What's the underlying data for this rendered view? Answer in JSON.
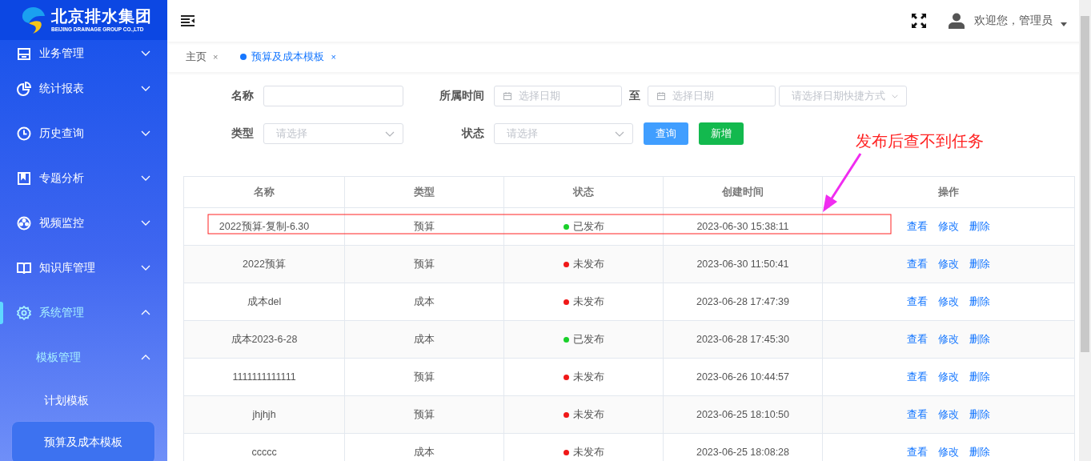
{
  "logo": {
    "title": "北京排水集团",
    "subtitle": "BEIJING DRAINAGE GROUP CO.,LTD"
  },
  "sidebar": {
    "items": [
      {
        "label": "业务管理",
        "expanded": false
      },
      {
        "label": "统计报表",
        "expanded": false
      },
      {
        "label": "历史查询",
        "expanded": false
      },
      {
        "label": "专题分析",
        "expanded": false
      },
      {
        "label": "视频监控",
        "expanded": false
      },
      {
        "label": "知识库管理",
        "expanded": false
      },
      {
        "label": "系统管理",
        "expanded": true,
        "children": [
          {
            "label": "模板管理",
            "expanded": true,
            "children": [
              {
                "label": "计划模板",
                "selected": false
              },
              {
                "label": "预算及成本模板",
                "selected": true
              }
            ]
          }
        ]
      }
    ]
  },
  "header": {
    "user": "欢迎您，管理员"
  },
  "tabs": [
    {
      "label": "主页",
      "close": "×",
      "selected": false
    },
    {
      "label": "预算及成本模板",
      "close": "×",
      "selected": true
    }
  ],
  "filters": {
    "name_label": "名称",
    "period_label": "所属时间",
    "date_from": {
      "placeholder": "选择日期"
    },
    "to_label": "至",
    "date_to": {
      "placeholder": "选择日期"
    },
    "quick": {
      "placeholder": "请选择日期快捷方式"
    },
    "type_label": "类型",
    "type": {
      "placeholder": "请选择"
    },
    "status_label": "状态",
    "status": {
      "placeholder": "请选择"
    },
    "buttons": [
      "查询",
      "新增"
    ]
  },
  "table": {
    "columns": [
      "名称",
      "类型",
      "状态",
      "创建时间",
      "操作"
    ],
    "rows": [
      {
        "name": "2022预算-复制-6.30",
        "type": "预算",
        "status": "已发布",
        "color": "#19d02a",
        "created": "2023-06-30 15:38:11",
        "actions": [
          "查看",
          "修改",
          "删除"
        ]
      },
      {
        "name": "2022预算",
        "type": "预算",
        "status": "未发布",
        "color": "#f01818",
        "created": "2023-06-30 11:50:41",
        "actions": [
          "查看",
          "修改",
          "删除"
        ]
      },
      {
        "name": "成本del",
        "type": "成本",
        "status": "未发布",
        "color": "#f01818",
        "created": "2023-06-28 17:47:39",
        "actions": [
          "查看",
          "修改",
          "删除"
        ]
      },
      {
        "name": "成本2023-6-28",
        "type": "成本",
        "status": "已发布",
        "color": "#19d02a",
        "created": "2023-06-28 17:45:30",
        "actions": [
          "查看",
          "修改",
          "删除"
        ]
      },
      {
        "name": "1111111111111",
        "type": "预算",
        "status": "未发布",
        "color": "#f01818",
        "created": "2023-06-26 10:44:57",
        "actions": [
          "查看",
          "修改",
          "删除"
        ]
      },
      {
        "name": "jhjhjh",
        "type": "预算",
        "status": "未发布",
        "color": "#f01818",
        "created": "2023-06-25 18:10:50",
        "actions": [
          "查看",
          "修改",
          "删除"
        ]
      },
      {
        "name": "ccccc",
        "type": "成本",
        "status": "未发布",
        "color": "#f01818",
        "created": "2023-06-25 18:08:28",
        "actions": [
          "查看",
          "修改",
          "删除"
        ]
      }
    ]
  },
  "annotation": {
    "text": "发布后查不到任务"
  }
}
